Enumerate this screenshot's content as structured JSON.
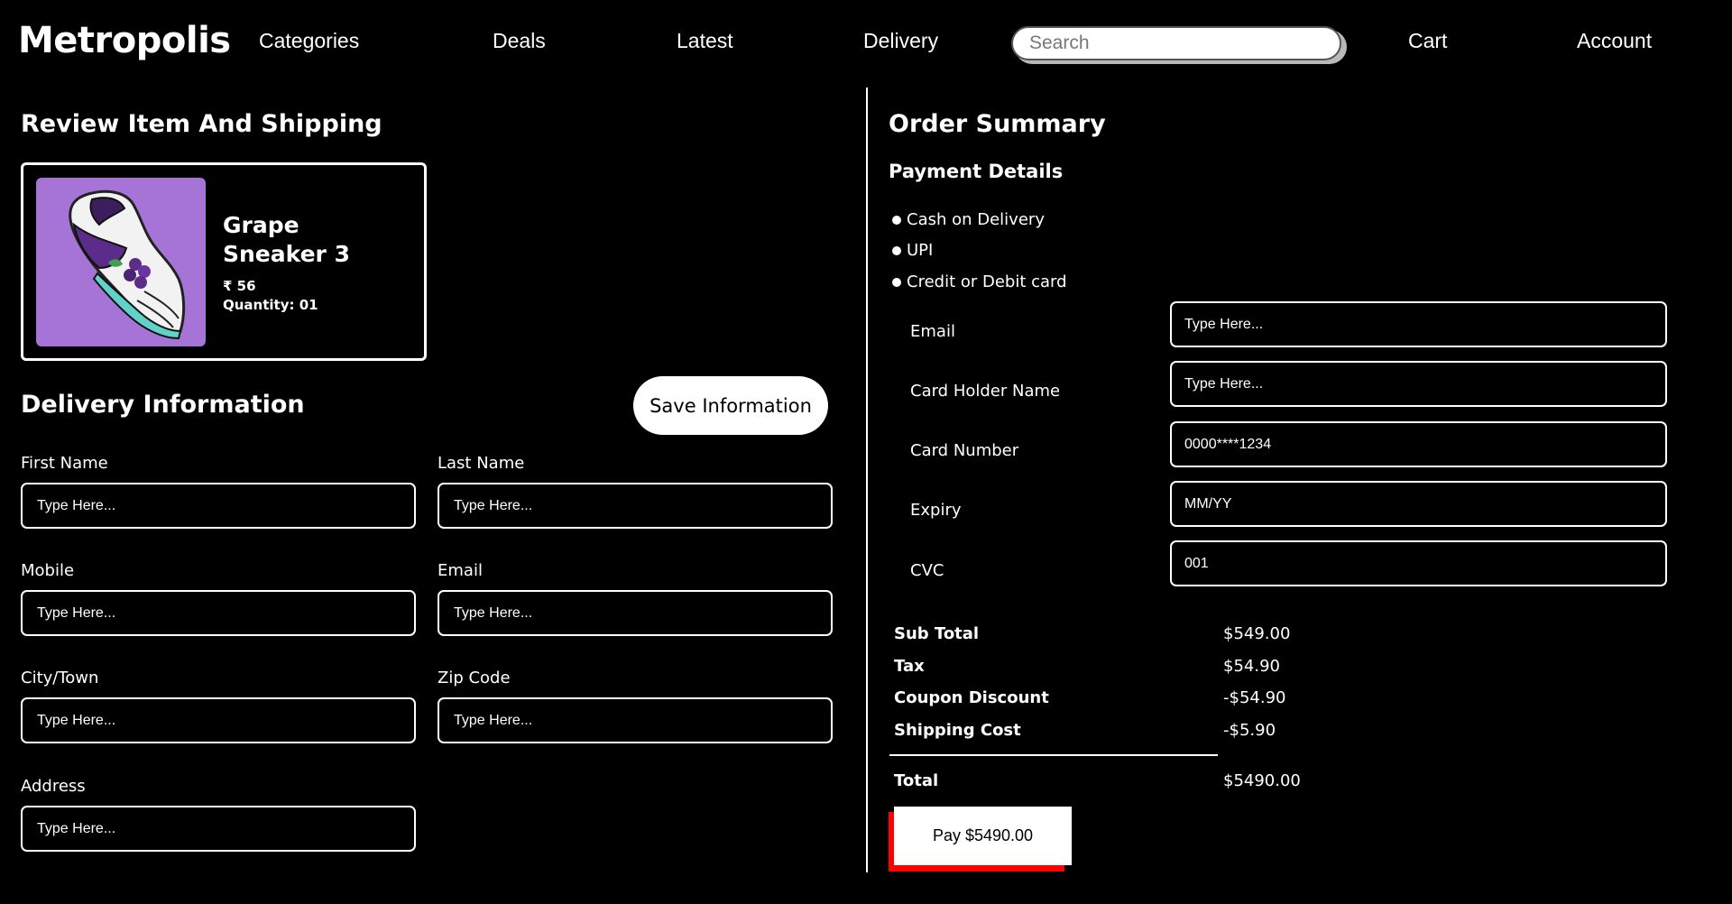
{
  "header": {
    "logo": "Metropolis",
    "nav": [
      "Categories",
      "Deals",
      "Latest",
      "Delivery"
    ],
    "search_placeholder": "Search",
    "cart": "Cart",
    "account": "Account"
  },
  "review": {
    "title": "Review Item And Shipping",
    "product": {
      "name": "Grape Sneaker 3",
      "price": "₹ 56",
      "quantity": "Quantity: 01",
      "image_bg": "#a574d6"
    }
  },
  "delivery": {
    "title": "Delivery Information",
    "save_button": "Save Information",
    "fields": [
      {
        "label": "First Name",
        "placeholder": "Type Here..."
      },
      {
        "label": "Last Name",
        "placeholder": "Type Here..."
      },
      {
        "label": "Mobile",
        "placeholder": "Type Here..."
      },
      {
        "label": "Email",
        "placeholder": "Type Here..."
      },
      {
        "label": "City/Town",
        "placeholder": "Type Here..."
      },
      {
        "label": "Zip Code",
        "placeholder": "Type Here..."
      },
      {
        "label": "Address",
        "placeholder": "Type Here..."
      }
    ]
  },
  "order": {
    "title": "Order Summary",
    "payment_title": "Payment Details",
    "methods": [
      "Cash on Delivery",
      "UPI",
      "Credit or Debit card"
    ],
    "card_fields": [
      {
        "label": "Email",
        "placeholder": "Type Here..."
      },
      {
        "label": "Card Holder Name",
        "placeholder": "Type Here..."
      },
      {
        "label": "Card Number",
        "placeholder": "0000****1234"
      },
      {
        "label": "Expiry",
        "placeholder": "MM/YY"
      },
      {
        "label": "CVC",
        "placeholder": "001"
      }
    ],
    "summary": [
      {
        "label": "Sub Total",
        "value": "$549.00"
      },
      {
        "label": "Tax",
        "value": "$54.90"
      },
      {
        "label": "Coupon Discount",
        "value": "-$54.90"
      },
      {
        "label": "Shipping Cost",
        "value": "-$5.90"
      }
    ],
    "total": {
      "label": "Total",
      "value": "$5490.00"
    },
    "pay_button": "Pay $5490.00",
    "accent_color": "#ff0000"
  }
}
